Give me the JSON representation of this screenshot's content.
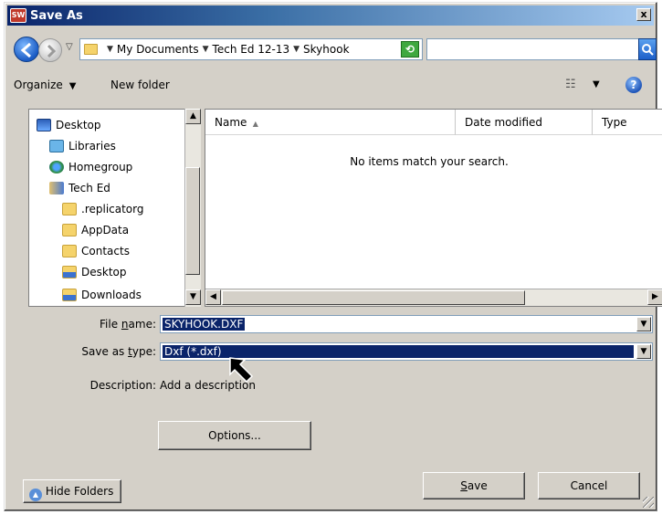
{
  "window": {
    "title": "Save As",
    "logo": "SW",
    "close": "x"
  },
  "address": {
    "crumbs": [
      "My Documents",
      "Tech Ed 12-13",
      "Skyhook"
    ],
    "search_value": ""
  },
  "toolbar": {
    "organize": "Organize",
    "new_folder": "New folder"
  },
  "tree": {
    "items": [
      {
        "label": "Desktop",
        "icon": "desktop-icon"
      },
      {
        "label": "Libraries",
        "icon": "libraries-icon"
      },
      {
        "label": "Homegroup",
        "icon": "homegroup-icon"
      },
      {
        "label": "Tech Ed",
        "icon": "user-folder-icon"
      },
      {
        "label": ".replicatorg",
        "icon": "folder-icon"
      },
      {
        "label": "AppData",
        "icon": "folder-icon"
      },
      {
        "label": "Contacts",
        "icon": "contacts-icon"
      },
      {
        "label": "Desktop",
        "icon": "desktop-folder-icon"
      },
      {
        "label": "Downloads",
        "icon": "downloads-icon"
      }
    ]
  },
  "list": {
    "columns": [
      "Name",
      "Date modified",
      "Type"
    ],
    "empty_message": "No items match your search."
  },
  "form": {
    "file_name_label_pre": "File ",
    "file_name_label_key": "n",
    "file_name_label_post": "ame:",
    "file_name_value": "SKYHOOK.DXF",
    "save_type_label_pre": "Save as ",
    "save_type_label_key": "t",
    "save_type_label_post": "ype:",
    "save_type_value": "Dxf (*.dxf)",
    "description_label": "Description:",
    "description_value": "Add a description"
  },
  "buttons": {
    "options": "Options...",
    "hide_folders": "Hide Folders",
    "save_key": "S",
    "save_rest": "ave",
    "cancel": "Cancel"
  }
}
